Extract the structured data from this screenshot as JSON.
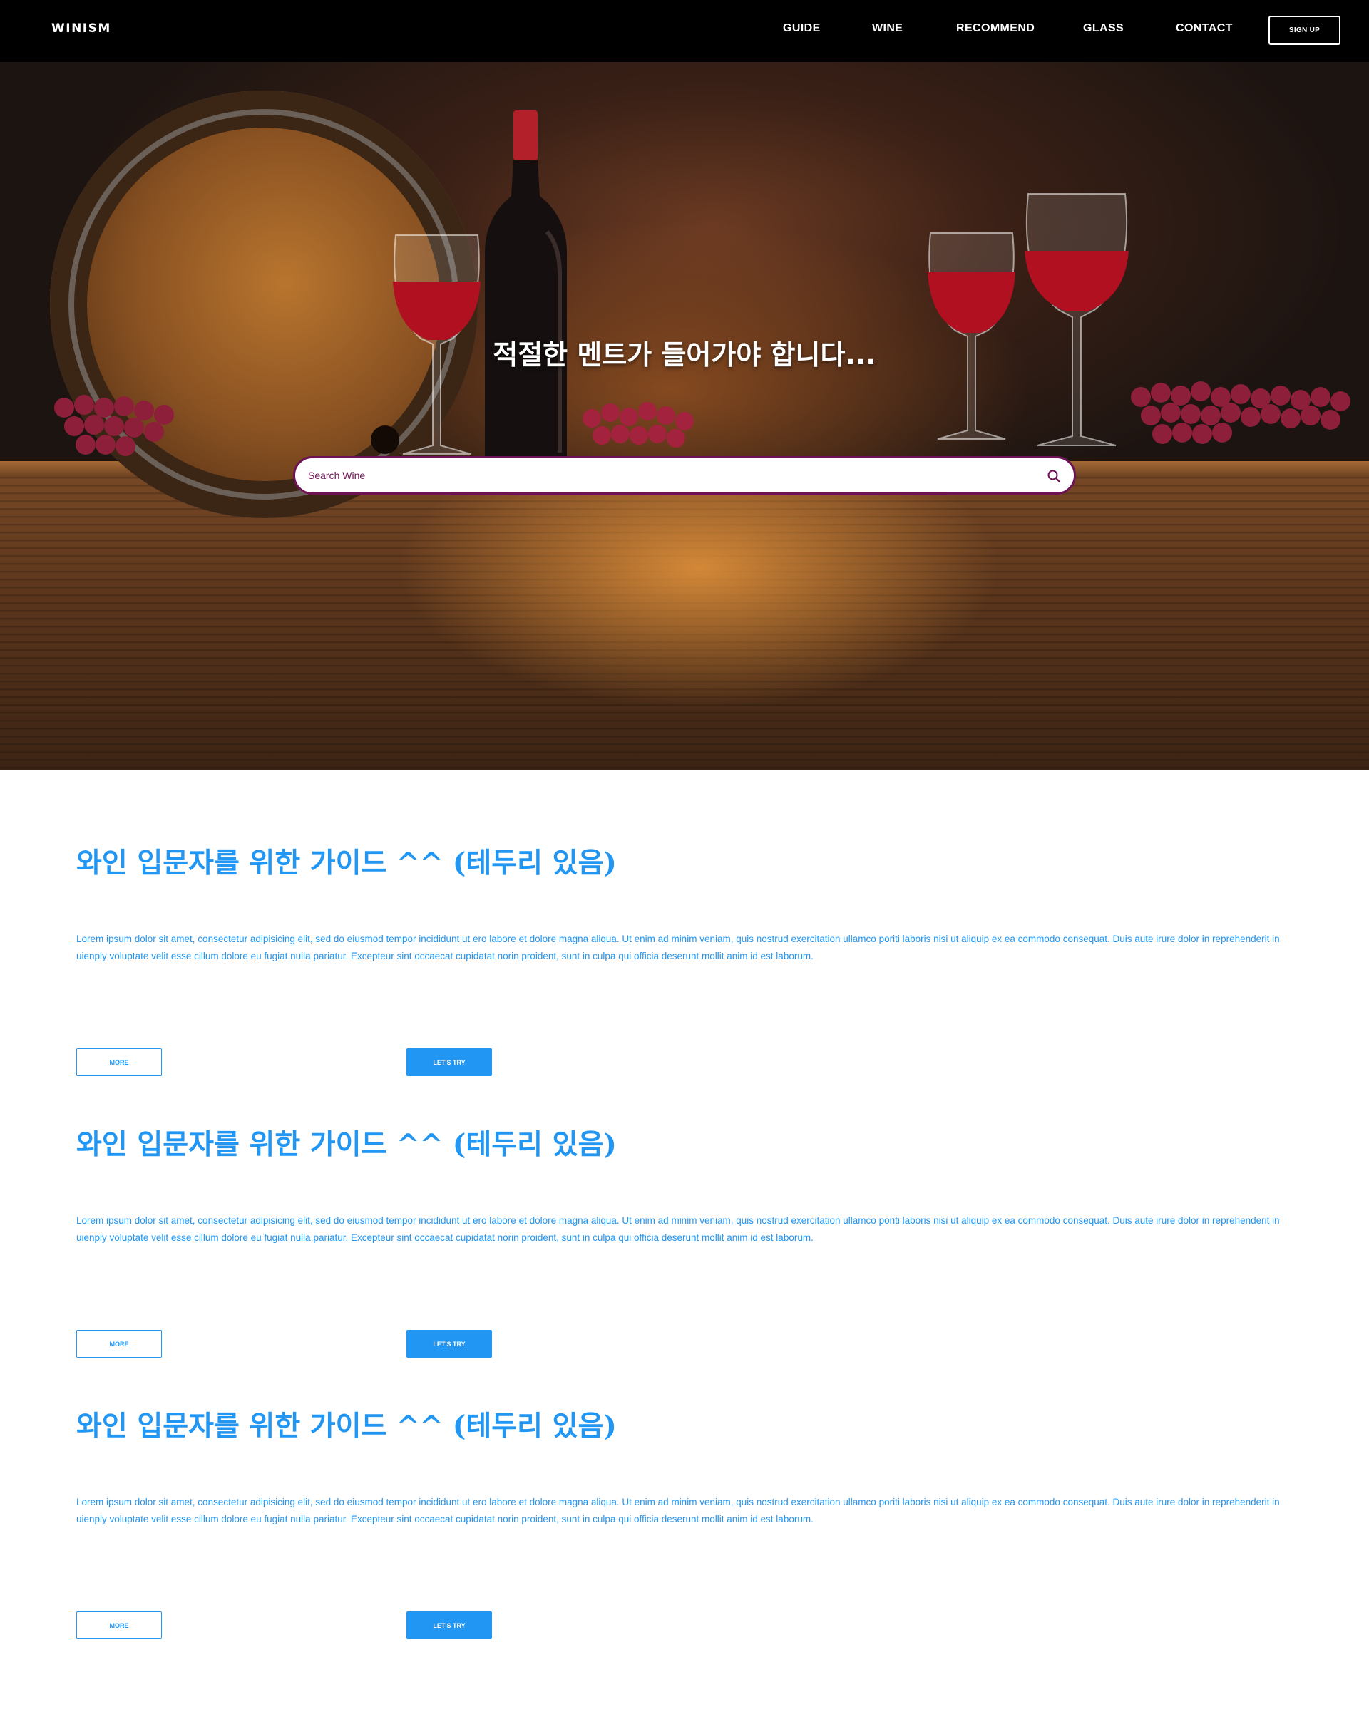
{
  "nav": {
    "logo": "WINISM",
    "items": [
      {
        "label": "GUIDE"
      },
      {
        "label": "WINE"
      },
      {
        "label": "RECOMMEND"
      },
      {
        "label": "GLASS"
      },
      {
        "label": "CONTACT"
      }
    ],
    "signup_label": "SIGN UP"
  },
  "hero": {
    "tagline": "적절한 멘트가 들어가야 합니다...",
    "search": {
      "placeholder": "Search Wine",
      "icon": "search-icon"
    }
  },
  "colors": {
    "accent": "#2196f3",
    "search_border": "#6e1256",
    "navbar": "#000000"
  },
  "sections": [
    {
      "title": "와인 입문자를 위한 가이드 ^^ (테두리 있음)",
      "text": "Lorem ipsum dolor sit amet, consectetur adipisicing elit, sed do eiusmod tempor incididunt ut ero labore et dolore magna aliqua. Ut enim ad minim veniam, quis nostrud exercitation ullamco poriti laboris nisi ut aliquip ex ea commodo consequat. Duis aute irure dolor in reprehenderit in uienply voluptate velit esse cillum dolore eu fugiat nulla pariatur. Excepteur sint occaecat cupidatat norin proident, sunt in culpa qui officia deserunt mollit anim id est laborum.",
      "more_label": "MORE",
      "try_label": "LET'S TRY"
    },
    {
      "title": "와인 입문자를 위한 가이드 ^^ (테두리 있음)",
      "text": "Lorem ipsum dolor sit amet, consectetur adipisicing elit, sed do eiusmod tempor incididunt ut ero labore et dolore magna aliqua. Ut enim ad minim veniam, quis nostrud exercitation ullamco poriti laboris nisi ut aliquip ex ea commodo consequat. Duis aute irure dolor in reprehenderit in uienply voluptate velit esse cillum dolore eu fugiat nulla pariatur. Excepteur sint occaecat cupidatat norin proident, sunt in culpa qui officia deserunt mollit anim id est laborum.",
      "more_label": "MORE",
      "try_label": "LET'S TRY"
    },
    {
      "title": "와인 입문자를 위한 가이드 ^^ (테두리 있음)",
      "text": "Lorem ipsum dolor sit amet, consectetur adipisicing elit, sed do eiusmod tempor incididunt ut ero labore et dolore magna aliqua. Ut enim ad minim veniam, quis nostrud exercitation ullamco poriti laboris nisi ut aliquip ex ea commodo consequat. Duis aute irure dolor in reprehenderit in uienply voluptate velit esse cillum dolore eu fugiat nulla pariatur. Excepteur sint occaecat cupidatat norin proident, sunt in culpa qui officia deserunt mollit anim id est laborum.",
      "more_label": "MORE",
      "try_label": "LET'S TRY"
    }
  ]
}
